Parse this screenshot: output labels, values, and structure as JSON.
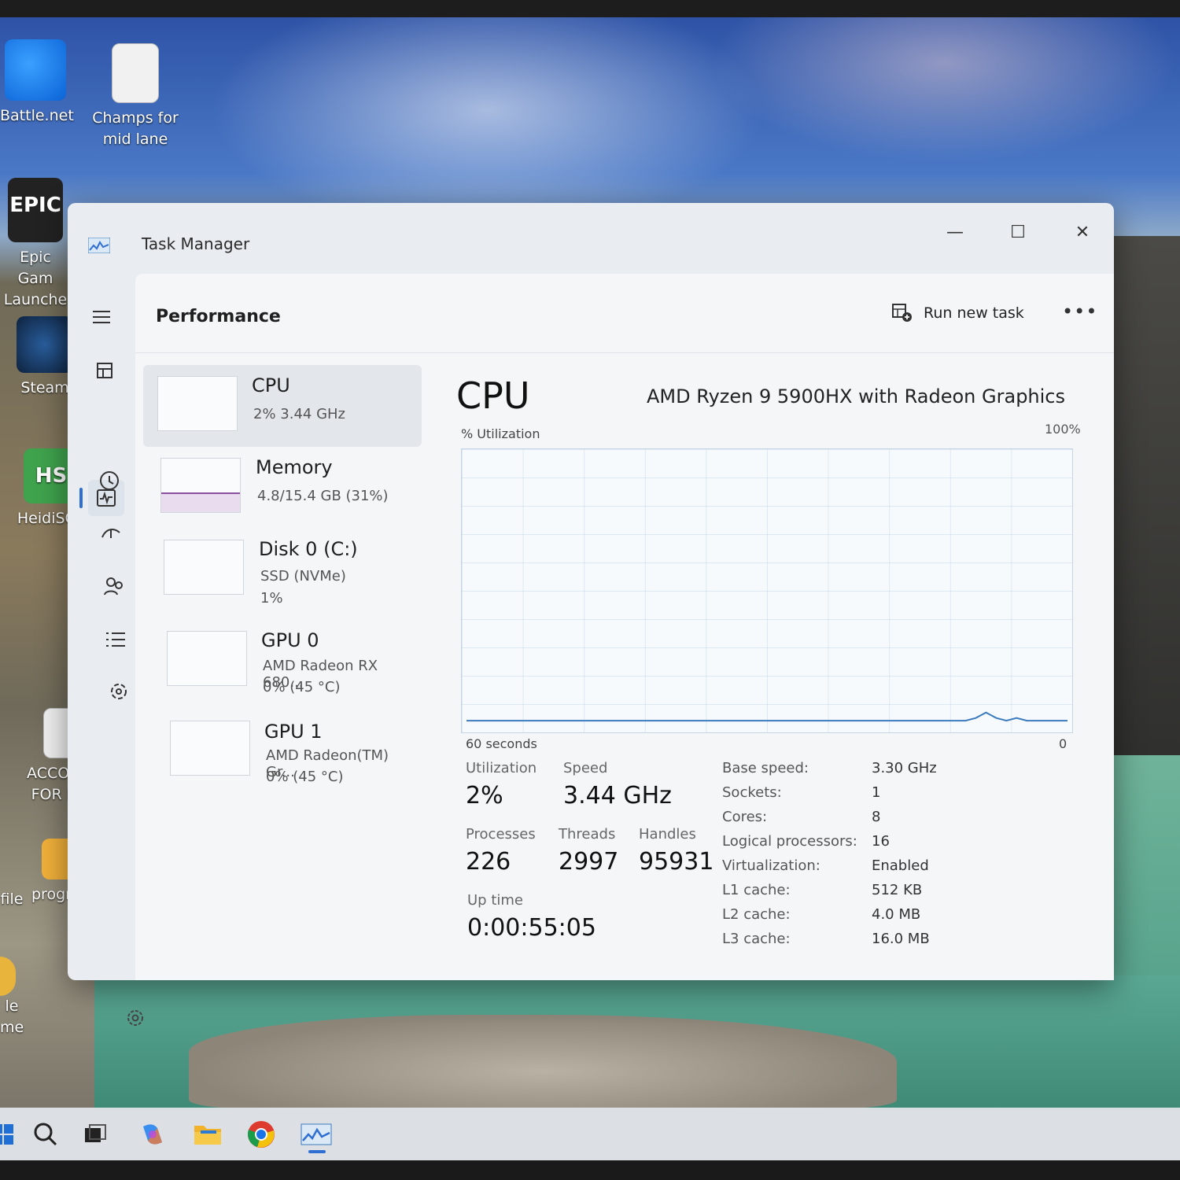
{
  "desktop": {
    "icons": [
      {
        "label": "Battle.net",
        "icon": "battlenet-icon"
      },
      {
        "label_lines": [
          "Champs for",
          "mid lane"
        ],
        "icon": "text-document-icon"
      },
      {
        "label_lines": [
          "Epic Gam",
          "Launche"
        ],
        "icon": "epic-games-icon",
        "badge": "EPIC"
      },
      {
        "label": "Steam",
        "icon": "steam-icon"
      },
      {
        "label": "HeidiSQL",
        "icon": "heidisql-icon",
        "badge": "HS"
      },
      {
        "label_lines": [
          "ACCOUNT",
          "FOR NEP"
        ],
        "icon": "text-document-icon"
      },
      {
        "label": "programm",
        "icon": "folder-icon"
      },
      {
        "label": "file",
        "icon": "file-icon"
      },
      {
        "label_lines": [
          "le",
          "me"
        ],
        "icon": "app-icon"
      }
    ]
  },
  "window": {
    "title": "Task Manager",
    "controls": {
      "minimize": "—",
      "maximize": "☐",
      "close": "✕"
    }
  },
  "nav": {
    "items": [
      {
        "icon": "hamburger-menu-icon"
      },
      {
        "icon": "processes-icon"
      },
      {
        "icon": "performance-icon",
        "active": true
      },
      {
        "icon": "app-history-icon"
      },
      {
        "icon": "startup-apps-icon"
      },
      {
        "icon": "users-icon"
      },
      {
        "icon": "details-icon"
      },
      {
        "icon": "services-icon"
      },
      {
        "icon": "settings-icon"
      }
    ]
  },
  "header": {
    "title": "Performance",
    "run_new_task": "Run new task",
    "more": "•••"
  },
  "resources": [
    {
      "name": "CPU",
      "sub1": "2%  3.44 GHz",
      "selected": true
    },
    {
      "name": "Memory",
      "sub1": "4.8/15.4 GB (31%)"
    },
    {
      "name": "Disk 0 (C:)",
      "sub1": "SSD (NVMe)",
      "sub2": "1%"
    },
    {
      "name": "GPU 0",
      "sub1": "AMD Radeon RX 680...",
      "sub2": "0%  (45 °C)"
    },
    {
      "name": "GPU 1",
      "sub1": "AMD Radeon(TM) Gr...",
      "sub2": "0%  (45 °C)"
    }
  ],
  "cpu": {
    "title": "CPU",
    "model": "AMD Ryzen 9 5900HX with Radeon Graphics",
    "graph_label": "% Utilization",
    "graph_max": "100%",
    "graph_time": "60 seconds",
    "graph_min": "0",
    "utilization_label": "Utilization",
    "utilization": "2%",
    "speed_label": "Speed",
    "speed": "3.44 GHz",
    "processes_label": "Processes",
    "processes": "226",
    "threads_label": "Threads",
    "threads": "2997",
    "handles_label": "Handles",
    "handles": "95931",
    "uptime_label": "Up time",
    "uptime": "0:00:55:05",
    "details": [
      {
        "k": "Base speed:",
        "v": "3.30 GHz"
      },
      {
        "k": "Sockets:",
        "v": "1"
      },
      {
        "k": "Cores:",
        "v": "8"
      },
      {
        "k": "Logical processors:",
        "v": "16"
      },
      {
        "k": "Virtualization:",
        "v": "Enabled"
      },
      {
        "k": "L1 cache:",
        "v": "512 KB"
      },
      {
        "k": "L2 cache:",
        "v": "4.0 MB"
      },
      {
        "k": "L3 cache:",
        "v": "16.0 MB"
      }
    ]
  },
  "chart_data": {
    "type": "line",
    "ylim": [
      0,
      100
    ],
    "xlabel": "60 seconds",
    "ylabel": "% Utilization",
    "series": [
      {
        "values": [
          2,
          2,
          2,
          2,
          2,
          2,
          2,
          2,
          2,
          2,
          2,
          2,
          2,
          2,
          2,
          2,
          2,
          2,
          2,
          2,
          2,
          2,
          2,
          2,
          2,
          2,
          2,
          2,
          2,
          2,
          2,
          2,
          2,
          2,
          2,
          2,
          2,
          2,
          2,
          2,
          2,
          2,
          2,
          2,
          2,
          2,
          2,
          2,
          2,
          2,
          3,
          5,
          3,
          2,
          3,
          2,
          2,
          2,
          2,
          2
        ]
      }
    ]
  },
  "taskbar": {
    "items": [
      {
        "icon": "start-icon"
      },
      {
        "icon": "search-icon"
      },
      {
        "icon": "task-view-icon"
      },
      {
        "icon": "copilot-icon"
      },
      {
        "icon": "file-explorer-icon"
      },
      {
        "icon": "chrome-icon"
      },
      {
        "icon": "task-manager-icon",
        "active": true
      }
    ]
  },
  "colors": {
    "accent": "#2f6fd2",
    "graph_line": "#3b7bbd",
    "memory_line": "#8a4fa0"
  }
}
